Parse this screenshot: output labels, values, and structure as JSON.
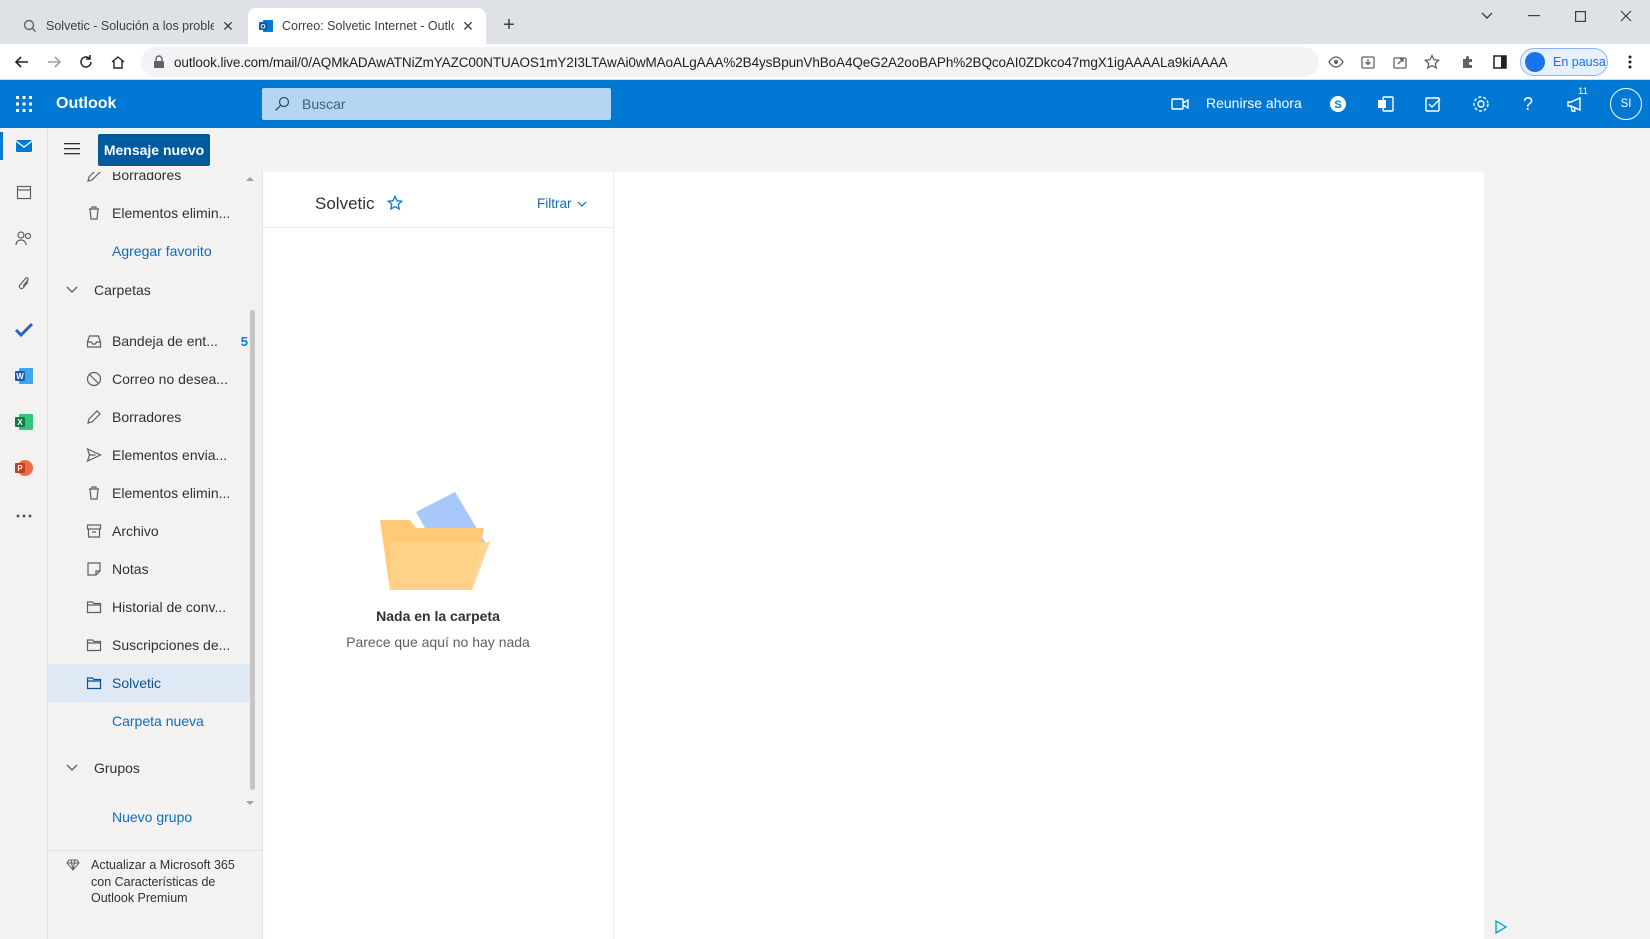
{
  "browser": {
    "tabs": [
      {
        "title": "Solvetic - Solución a los problemas"
      },
      {
        "title": "Correo: Solvetic Internet - Outlook"
      }
    ],
    "url": "outlook.live.com/mail/0/AQMkADAwATNiZmYAZC00NTUAOS1mY2I3LTAwAi0wMAoALgAAA%2B4ysBpunVhBoA4QeG2A2ooBAPh%2BQcoAI0ZDkco47mgX1igAAAALa9kiAAAA",
    "profile_label": "En pausa"
  },
  "topbar": {
    "app_name": "Outlook",
    "search_placeholder": "Buscar",
    "meet_now": "Reunirse ahora",
    "notifications_count": "11",
    "avatar_initials": "SI"
  },
  "appbar": {
    "new_message": "Mensaje nuevo"
  },
  "folders": {
    "favorites": [
      {
        "label": "Borradores",
        "icon": "pencil-icon"
      },
      {
        "label": "Elementos elimin...",
        "icon": "trash-icon"
      }
    ],
    "add_favorite": "Agregar favorito",
    "folders_header": "Carpetas",
    "items": [
      {
        "label": "Bandeja de ent...",
        "icon": "inbox-icon",
        "count": "5"
      },
      {
        "label": "Correo no desea...",
        "icon": "blocked-icon",
        "count": ""
      },
      {
        "label": "Borradores",
        "icon": "pencil-icon",
        "count": ""
      },
      {
        "label": "Elementos envia...",
        "icon": "send-icon",
        "count": ""
      },
      {
        "label": "Elementos elimin...",
        "icon": "trash-icon",
        "count": ""
      },
      {
        "label": "Archivo",
        "icon": "archive-icon",
        "count": ""
      },
      {
        "label": "Notas",
        "icon": "note-icon",
        "count": ""
      },
      {
        "label": "Historial de conv...",
        "icon": "folder-icon",
        "count": ""
      },
      {
        "label": "Suscripciones de...",
        "icon": "folder-icon",
        "count": ""
      },
      {
        "label": "Solvetic",
        "icon": "folder-icon",
        "count": ""
      }
    ],
    "new_folder": "Carpeta nueva",
    "groups_header": "Grupos",
    "new_group": "Nuevo grupo"
  },
  "upgrade": {
    "text": "Actualizar a Microsoft 365 con Características de Outlook Premium"
  },
  "message_list": {
    "folder_title": "Solvetic",
    "filter_label": "Filtrar",
    "empty_title": "Nada en la carpeta",
    "empty_subtitle": "Parece que aquí no hay nada"
  },
  "colors": {
    "brand": "#0078d4",
    "selected_folder": "#dfe9f5"
  }
}
